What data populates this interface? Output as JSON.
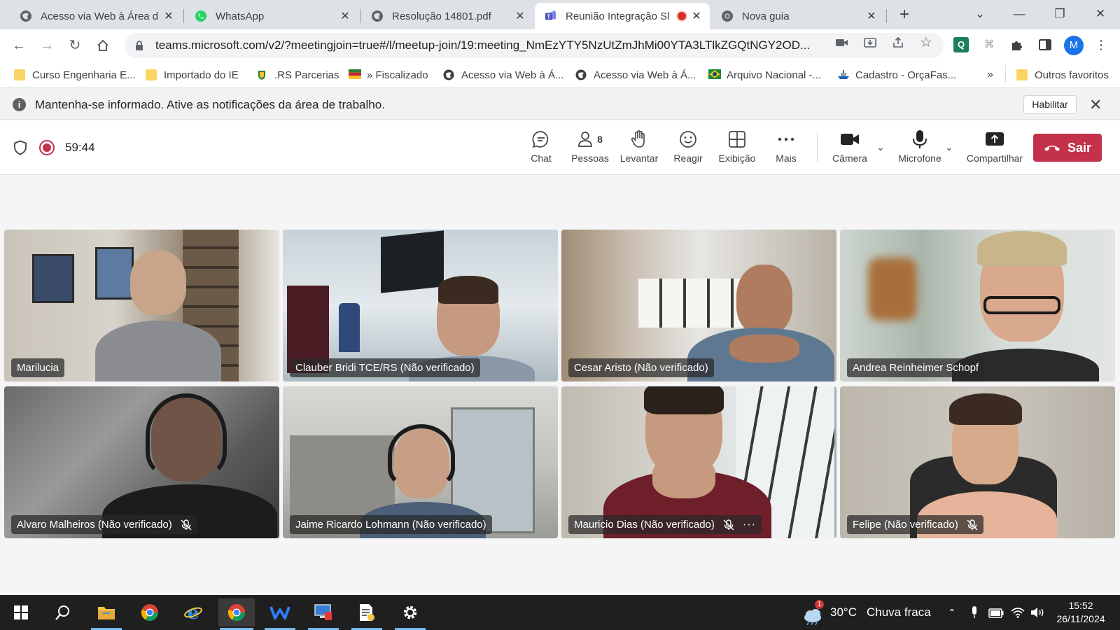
{
  "browser": {
    "tabs": [
      {
        "title": "Acesso via Web à Área de",
        "icon": "globe-icon"
      },
      {
        "title": "WhatsApp",
        "icon": "whatsapp-icon"
      },
      {
        "title": "Resolução 14801.pdf",
        "icon": "globe-icon"
      },
      {
        "title": "Reunião Integração Sl",
        "icon": "teams-icon",
        "active": true,
        "recording": true
      },
      {
        "title": "Nova guia",
        "icon": "chrome-icon"
      }
    ],
    "url": "teams.microsoft.com/v2/?meetingjoin=true#/l/meetup-join/19:meeting_NmEzYTY5NzUtZmJhMi00YTA3LTlkZGQtNGY2OD...",
    "profile_initial": "M",
    "extension_label": "Q",
    "bookmarks": [
      {
        "label": "Curso Engenharia E...",
        "icon": "folder-icon"
      },
      {
        "label": "Importado do IE",
        "icon": "folder-icon"
      },
      {
        "label": ".RS Parcerias",
        "icon": "crest-icon"
      },
      {
        "label": "» Fiscalizado",
        "icon": "flag-icon"
      },
      {
        "label": "Acesso via Web à Á...",
        "icon": "globe-icon"
      },
      {
        "label": "Acesso via Web à Á...",
        "icon": "globe-icon"
      },
      {
        "label": "Arquivo Nacional -...",
        "icon": "brazil-flag-icon"
      },
      {
        "label": "Cadastro - OrçaFas...",
        "icon": "ship-icon"
      }
    ],
    "bookmarks_overflow": "»",
    "other_favorites": "Outros favoritos"
  },
  "notification": {
    "message": "Mantenha-se informado. Ative as notificações da área de trabalho.",
    "enable_label": "Habilitar"
  },
  "meeting": {
    "timer": "59:44",
    "controls": {
      "chat": "Chat",
      "people": "Pessoas",
      "people_count": "8",
      "raise": "Levantar",
      "react": "Reagir",
      "view": "Exibição",
      "more": "Mais",
      "camera": "Câmera",
      "mic": "Microfone",
      "share": "Compartilhar",
      "leave": "Sair"
    },
    "participants": [
      {
        "name": "Marilucia",
        "muted": false,
        "speaking": false
      },
      {
        "name": "Clauber Bridi TCE/RS (Não verificado)",
        "muted": false,
        "speaking": true
      },
      {
        "name": "Cesar Aristo (Não verificado)",
        "muted": false,
        "speaking": true
      },
      {
        "name": "Andrea Reinheimer Schopf",
        "muted": false,
        "speaking": false
      },
      {
        "name": "Alvaro Malheiros (Não verificado)",
        "muted": true,
        "speaking": false
      },
      {
        "name": "Jaime Ricardo Lohmann (Não verificado)",
        "muted": false,
        "speaking": false
      },
      {
        "name": "Mauricio Dias (Não verificado)",
        "muted": true,
        "speaking": false,
        "more": "···"
      },
      {
        "name": "Felipe (Não verificado)",
        "muted": true,
        "speaking": false
      }
    ]
  },
  "taskbar": {
    "weather_temp": "30°C",
    "weather_desc": "Chuva fraca",
    "weather_badge": "1",
    "time": "15:52",
    "date": "26/11/2024"
  },
  "colors": {
    "teams_purple": "#6264a7",
    "leave_red": "#c4314b",
    "taskbar": "#1f1f1f"
  }
}
